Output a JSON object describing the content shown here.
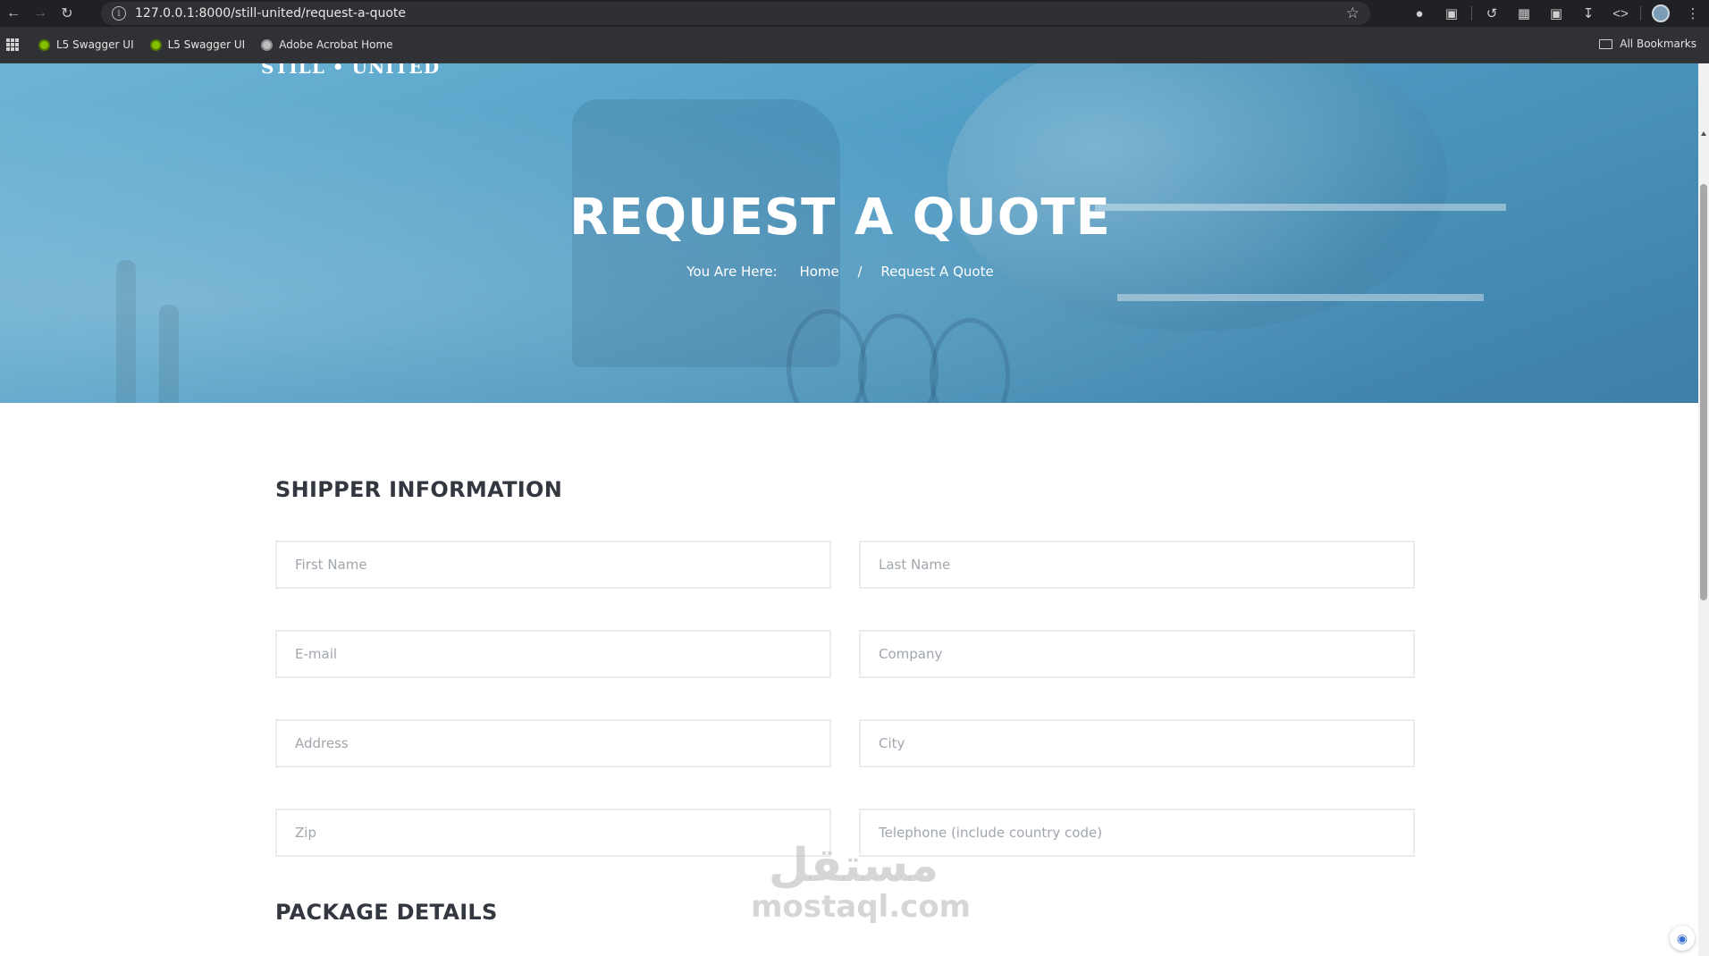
{
  "browser": {
    "url": "127.0.0.1:8000/still-united/request-a-quote",
    "bookmarks": [
      "L5 Swagger UI",
      "L5 Swagger UI",
      "Adobe Acrobat Home"
    ],
    "all_bookmarks": "All Bookmarks"
  },
  "hero": {
    "brand": "STILL • UNITED",
    "title": "REQUEST A QUOTE",
    "breadcrumb": {
      "label": "You Are Here:",
      "home": "Home",
      "separator": "/",
      "current": "Request A Quote"
    }
  },
  "shipper": {
    "title": "SHIPPER INFORMATION",
    "fields": {
      "first_name": "First Name",
      "last_name": "Last Name",
      "email": "E-mail",
      "company": "Company",
      "address": "Address",
      "city": "City",
      "zip": "Zip",
      "telephone": "Telephone (include country code)"
    }
  },
  "package": {
    "title": "PACKAGE DETAILS"
  },
  "watermark": {
    "arabic": "مستقل",
    "latin": "mostaql.com"
  },
  "colors": {
    "hero_start": "#6db5d6",
    "hero_end": "#3d7fa7",
    "heading": "#333740",
    "field_border": "#ececec"
  }
}
